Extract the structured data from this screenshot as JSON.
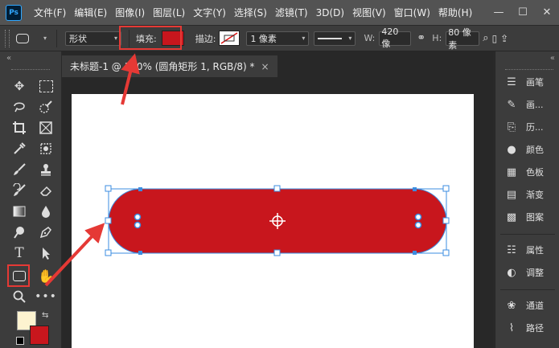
{
  "menubar": {
    "logo": "Ps",
    "items": [
      "文件(F)",
      "编辑(E)",
      "图像(I)",
      "图层(L)",
      "文字(Y)",
      "选择(S)",
      "滤镜(T)",
      "3D(D)",
      "视图(V)",
      "窗口(W)",
      "帮助(H)"
    ],
    "window_controls": [
      "—",
      "☐",
      "✕"
    ]
  },
  "options": {
    "mode": "形状",
    "fill_label": "填充:",
    "fill_color": "#c8161d",
    "stroke_label": "描边:",
    "stroke_width": "1 像素",
    "width_label": "W:",
    "width_value": "420 像",
    "height_label": "H:",
    "height_value": "80 像素"
  },
  "document": {
    "tab_title": "未标题-1 @ 100% (圆角矩形 1, RGB/8) *",
    "tab_close": "×",
    "shape_color": "#c8161d"
  },
  "right_panel": {
    "items": [
      "画笔",
      "画...",
      "历...",
      "颜色",
      "色板",
      "渐变",
      "图案",
      "属性",
      "调整",
      "通道",
      "路径"
    ]
  },
  "colors": {
    "foreground": "#fdf3d0",
    "background": "#c8161d",
    "highlight": "#e53935"
  },
  "panel_collapse": "«"
}
